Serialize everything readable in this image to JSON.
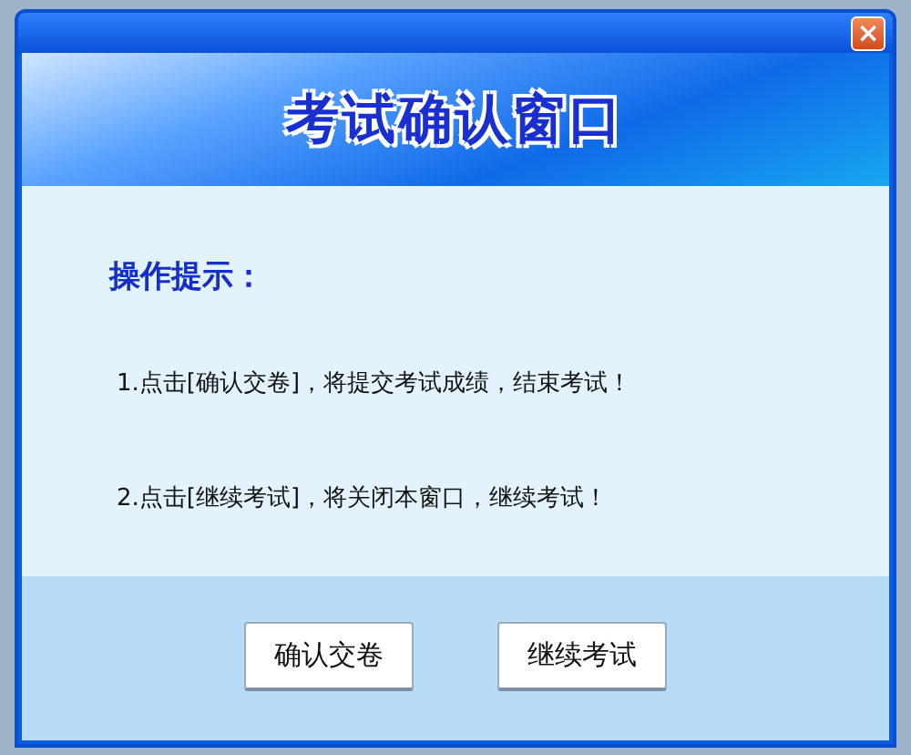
{
  "dialog": {
    "banner_title": "考试确认窗口",
    "close": "×",
    "heading": "操作提示：",
    "tips": [
      "1.点击[确认交卷]，将提交考试成绩，结束考试！",
      "2.点击[继续考试]，将关闭本窗口，继续考试！"
    ],
    "buttons": [
      "确认交卷",
      "继续考试"
    ]
  }
}
